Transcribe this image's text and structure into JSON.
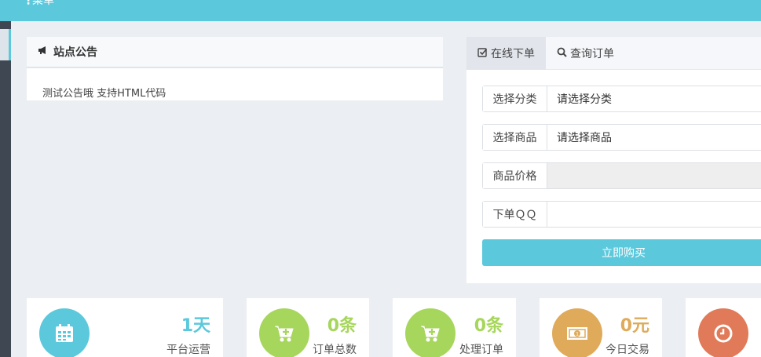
{
  "topbar": {
    "menu_label": "菜单"
  },
  "notice": {
    "title": "站点公告",
    "content": "测试公告哦 支持HTML代码"
  },
  "order": {
    "tabs": [
      {
        "label": "在线下单"
      },
      {
        "label": "查询订单"
      }
    ],
    "fields": {
      "category": {
        "label": "选择分类",
        "value": "请选择分类"
      },
      "product": {
        "label": "选择商品",
        "value": "请选择商品"
      },
      "price": {
        "label": "商品价格",
        "value": ""
      },
      "qq": {
        "label": "下单ＱＱ",
        "placeholder": ""
      }
    },
    "buy_label": "立即购买"
  },
  "stats": [
    {
      "value": "1天",
      "caption": "平台运营",
      "color": "#5bc8dc",
      "icon": "calendar-icon"
    },
    {
      "value": "0条",
      "caption": "订单总数",
      "color": "#a7d65c",
      "icon": "cart-plus-icon"
    },
    {
      "value": "0条",
      "caption": "处理订单",
      "color": "#a7d65c",
      "icon": "cart-plus-icon"
    },
    {
      "value": "0元",
      "caption": "今日交易",
      "color": "#dfab5a",
      "icon": "money-icon"
    },
    {
      "value": "",
      "caption": "",
      "color": "#e07a58",
      "icon": "clock-icon"
    }
  ]
}
